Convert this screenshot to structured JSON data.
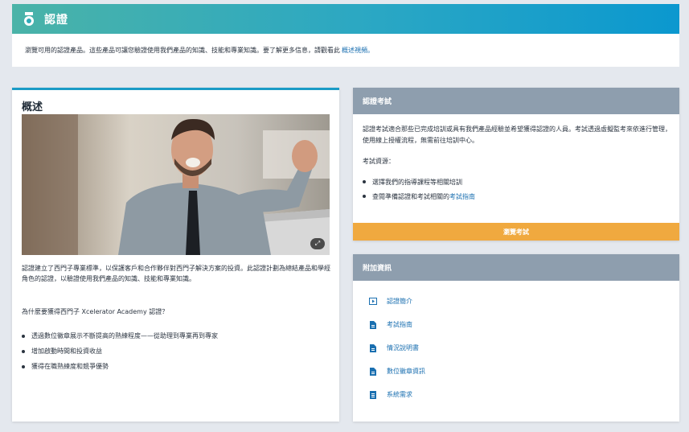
{
  "header": {
    "title": "認證",
    "icon": "medal-icon",
    "gradient": [
      "#4ab3a8",
      "#0b98cf"
    ]
  },
  "intro": {
    "text": "瀏覽可用的認證產品。這些產品可讓您驗證使用我們產品的知識、技能和專業知識。要了解更多信息，請觀看此",
    "link": "概述視頻。"
  },
  "overview": {
    "title": "概述",
    "image_alt": "man celebrating at laptop",
    "description": "認證建立了西門子專業標準，以保護客戶和合作夥伴對西門子解決方案的投資。此認證計劃為總結產品和學經角色的認證，以驗證使用我們產品的知識、技能和專業知識。",
    "why_title": "為什麼要獲得西門子 Xcelerator Academy 認證？",
    "benefits": [
      "透過數位徽章展示不斷提高的熟練程度——從助理到專業再到專家",
      "增加啟動時間和投資收益",
      "獲得在職熟練度和競爭優勢"
    ]
  },
  "exam": {
    "title": "認證考試",
    "description": "認證考試適合那些已完成培訓或具有我們產品經驗並希望獲得認證的人員。考試透過虛擬監考來依進行管理，使用線上授權流程，無需前往培訓中心。",
    "resources_title": "考試資源：",
    "resources": [
      {
        "text": "選擇我們的指導課程等相關培訓",
        "link": ""
      },
      {
        "text": "查閱準備認證和考試相關的",
        "link": "考試指南"
      }
    ],
    "button_label": "瀏覽考試",
    "button_color": "#f0a93f"
  },
  "additional": {
    "title": "附加資訊",
    "items": [
      {
        "icon": "video-icon",
        "label": "認證簡介"
      },
      {
        "icon": "document-icon",
        "label": "考試指南"
      },
      {
        "icon": "document-icon",
        "label": "情況說明書"
      },
      {
        "icon": "document-icon",
        "label": "數位徽章資訊"
      },
      {
        "icon": "list-icon",
        "label": "系統需求"
      }
    ]
  }
}
